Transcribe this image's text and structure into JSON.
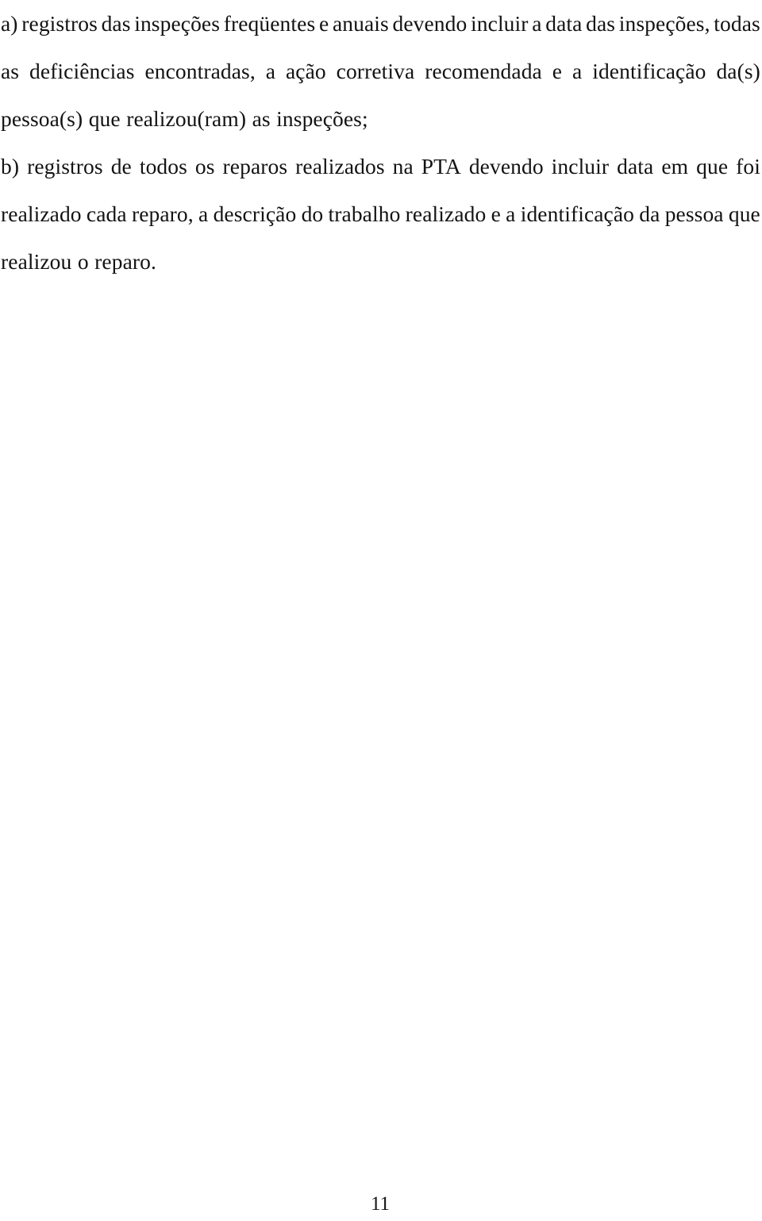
{
  "document": {
    "language": "pt-BR",
    "body": {
      "items": [
        {
          "marker": "a)",
          "lines": [
            {
              "justified": true,
              "words": [
                "a)",
                "registros",
                "das",
                "inspeções",
                "freqüentes",
                "e",
                "anuais",
                "devendo",
                "incluir",
                "a",
                "data",
                "das",
                "inspeções,",
                "todas"
              ]
            },
            {
              "justified": true,
              "words": [
                "as",
                "deficiências",
                "encontradas,",
                "a",
                "ação",
                "corretiva",
                "recomendada",
                "e",
                "a",
                "identificação",
                "da(s)"
              ]
            },
            {
              "justified": false,
              "text": "pessoa(s) que realizou(ram) as inspeções;"
            }
          ],
          "full_text": "a) registros das inspeções freqüentes e anuais devendo incluir a data das inspeções, todas as deficiências encontradas, a ação corretiva recomendada e a identificação da(s) pessoa(s) que realizou(ram) as inspeções;"
        },
        {
          "marker": "b)",
          "lines": [
            {
              "justified": true,
              "words": [
                "b)",
                "registros",
                "de",
                "todos",
                "os",
                "reparos",
                "realizados",
                "na",
                "PTA",
                "devendo",
                "incluir",
                "data",
                "em",
                "que",
                "foi"
              ]
            },
            {
              "justified": true,
              "words": [
                "realizado",
                "cada",
                "reparo,",
                "a",
                "descrição",
                "do",
                "trabalho",
                "realizado",
                "e",
                "a",
                "identificação",
                "da",
                "pessoa",
                "que"
              ]
            },
            {
              "justified": false,
              "text": "realizou o reparo."
            }
          ],
          "full_text": "b) registros de todos os reparos realizados na PTA devendo incluir data em que foi realizado cada reparo, a descrição do trabalho realizado e a identificação da pessoa que realizou o reparo."
        }
      ]
    },
    "footer": {
      "page_number": "11"
    },
    "colors": {
      "page_background": "#ffffff",
      "text": "#131313"
    }
  }
}
